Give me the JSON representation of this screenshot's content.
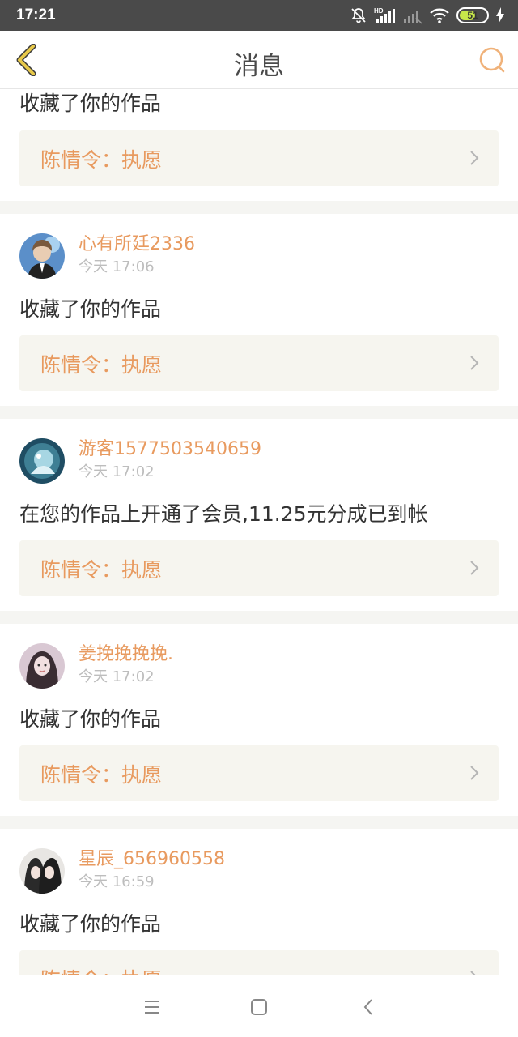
{
  "status_bar": {
    "time": "17:21",
    "battery": "51",
    "icons": [
      "bell-muted-icon",
      "hd-signal-icon",
      "signal-weak-icon",
      "wifi-icon",
      "battery-icon",
      "charging-icon"
    ]
  },
  "header": {
    "title": "消息",
    "back_icon": "chevron-left-icon",
    "search_icon": "search-icon"
  },
  "colors": {
    "accent": "#e89a5f",
    "back_accent": "#e8c94a",
    "link_bg": "#f6f5ef"
  },
  "partial_top": {
    "action": "收藏了你的作品",
    "work_title": "陈情令：执愿"
  },
  "messages": [
    {
      "user": "心有所廷2336",
      "time": "今天 17:06",
      "action": "收藏了你的作品",
      "work_title": "陈情令：执愿"
    },
    {
      "user": "游客1577503540659",
      "time": "今天 17:02",
      "action": "在您的作品上开通了会员,11.25元分成已到帐",
      "work_title": "陈情令：执愿"
    },
    {
      "user": "姜挽挽挽挽.",
      "time": "今天 17:02",
      "action": "收藏了你的作品",
      "work_title": "陈情令：执愿"
    },
    {
      "user": "星辰_656960558",
      "time": "今天 16:59",
      "action": "收藏了你的作品",
      "work_title": "陈情令：执愿"
    }
  ],
  "system_nav": [
    "menu-icon",
    "home-icon",
    "back-icon"
  ]
}
